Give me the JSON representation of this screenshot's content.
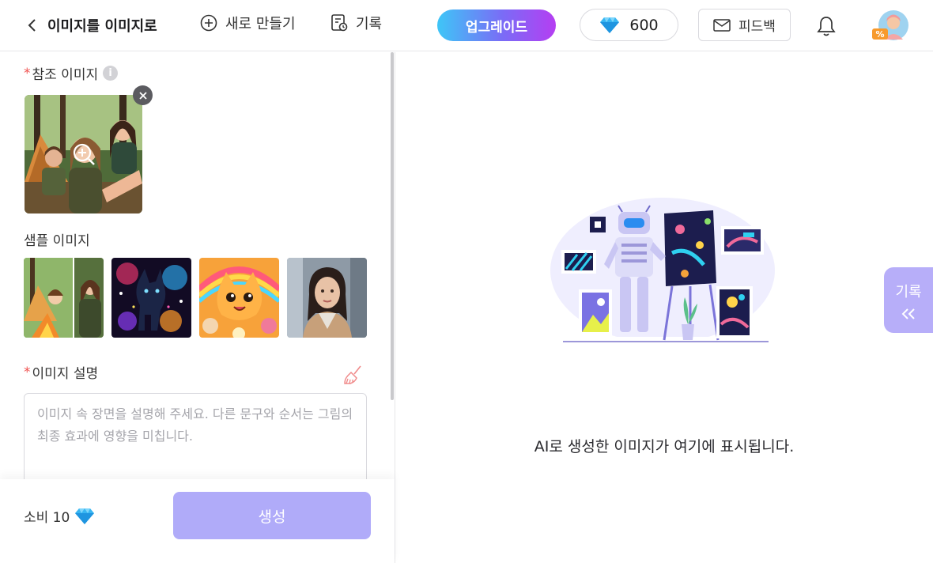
{
  "header": {
    "title": "이미지를 이미지로",
    "new_label": "새로 만들기",
    "history_label": "기록",
    "upgrade_label": "업그레이드",
    "credits": "600",
    "feedback_label": "피드백"
  },
  "left": {
    "ref_label": "참조 이미지",
    "required_mark": "*",
    "samples_label": "샘플 이미지",
    "desc_label": "이미지 설명",
    "desc_placeholder": "이미지 속 장면을 설명해 주세요. 다른 문구와 순서는 그림의 최종 효과에 영향을 미칩니다.",
    "cost_label": "소비 10",
    "generate_label": "생성"
  },
  "right": {
    "placeholder_text": "AI로 생성한 이미지가 여기에 표시됩니다.",
    "history_tab_label": "기록"
  },
  "colors": {
    "accent": "#b0abf9",
    "required": "#f0514f",
    "upgrade_start": "#3ec6f7",
    "upgrade_end": "#b53ef2"
  }
}
